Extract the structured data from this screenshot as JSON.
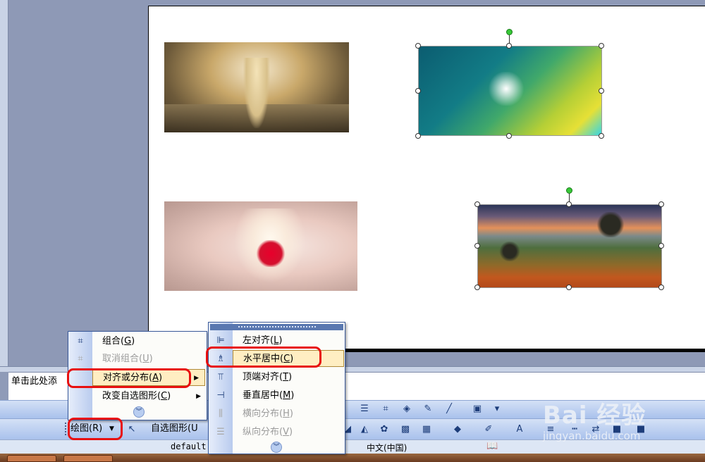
{
  "notes": {
    "placeholder_text": "单击此处添"
  },
  "draw_menu": {
    "items": [
      {
        "label": "组合(",
        "underline": "G",
        "tail": ")",
        "icon": "group-icon",
        "enabled": true
      },
      {
        "label": "取消组合(",
        "underline": "U",
        "tail": ")",
        "icon": "ungroup-icon",
        "enabled": false
      },
      {
        "label": "对齐或分布(",
        "underline": "A",
        "tail": ")",
        "icon": "",
        "enabled": true,
        "submenu": true,
        "highlighted": true
      },
      {
        "label": "改变自选图形(",
        "underline": "C",
        "tail": ")",
        "icon": "",
        "enabled": true,
        "submenu": true
      }
    ],
    "expand_icon": "double-chevron-down-icon"
  },
  "align_submenu": {
    "items": [
      {
        "label": "左对齐(",
        "underline": "L",
        "tail": ")",
        "icon": "align-left-icon",
        "enabled": true
      },
      {
        "label": "水平居中(",
        "underline": "C",
        "tail": ")",
        "icon": "align-center-icon",
        "enabled": true,
        "highlighted": true
      },
      {
        "label": "顶端对齐(",
        "underline": "T",
        "tail": ")",
        "icon": "align-top-icon",
        "enabled": true
      },
      {
        "label": "垂直居中(",
        "underline": "M",
        "tail": ")",
        "icon": "align-middle-icon",
        "enabled": true
      },
      {
        "label": "横向分布(",
        "underline": "H",
        "tail": ")",
        "icon": "distribute-horizontal-icon",
        "enabled": false
      },
      {
        "label": "纵向分布(",
        "underline": "V",
        "tail": ")",
        "icon": "distribute-vertical-icon",
        "enabled": false
      }
    ],
    "expand_icon": "double-chevron-down-icon"
  },
  "drawing_toolbar": {
    "draw_button": "绘图(R)",
    "autoshapes_button": "自选图形(U"
  },
  "status_bar": {
    "template": "default",
    "language": "中文(中国)"
  },
  "watermark": {
    "logo": "Bai 经验",
    "site": "jingyan.baidu.com"
  },
  "colors": {
    "highlight": "#ffeec2",
    "menu_rail": "#b9cbee",
    "annotation_red": "#e81010",
    "toolbar": "#a9c1ec"
  }
}
